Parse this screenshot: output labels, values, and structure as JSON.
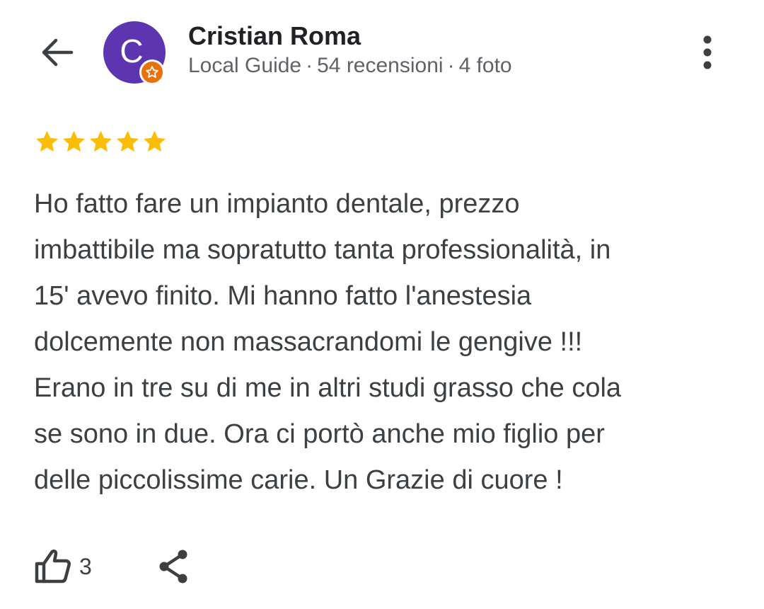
{
  "header": {
    "back_icon": "arrow-back-icon",
    "avatar_initial": "C",
    "badge_icon": "local-guide-star-icon",
    "user_name": "Cristian Roma",
    "user_role": "Local Guide",
    "separator": "·",
    "review_count": "54 recensioni",
    "photo_count": "4 foto",
    "more_icon": "more-vert-icon"
  },
  "review": {
    "rating": 5,
    "rating_max": 5,
    "star_color": "#fbbc04",
    "text": "Ho fatto fare un impianto dentale, prezzo\nimbattibile ma sopratutto tanta professionalità, in\n15' avevo finito. Mi hanno fatto l'anestesia\ndolcemente non massacrandomi le gengive !!!\nErano in tre su di me in altri studi grasso che cola\nse sono in due. Ora ci portò anche mio figlio per\ndelle piccolissime carie. Un Grazie di cuore !"
  },
  "actions": {
    "like_icon": "thumb-up-icon",
    "like_count": "3",
    "share_icon": "share-icon"
  },
  "colors": {
    "avatar_bg": "#5e35b1",
    "badge_bg": "#e8710a",
    "text_primary": "#202124",
    "text_secondary": "#5f6368"
  }
}
